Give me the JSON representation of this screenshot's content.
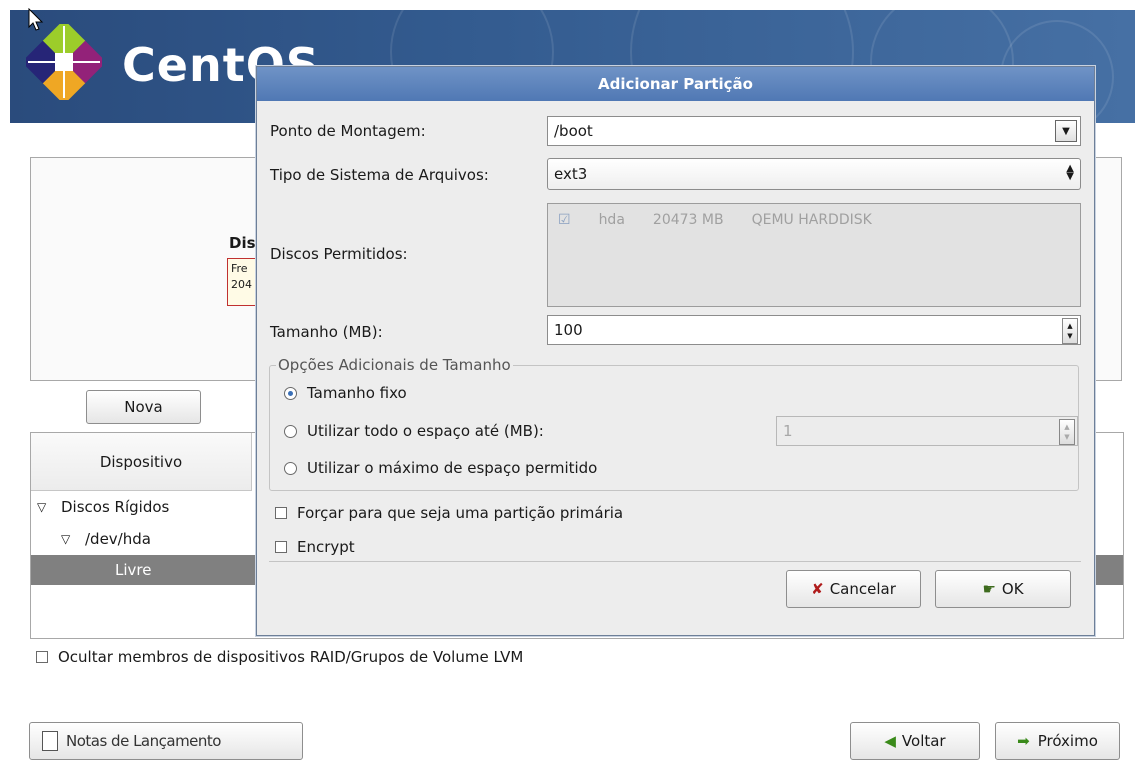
{
  "installer": {
    "logo_text": "CentOS",
    "disk_caption": "Dis",
    "disk_box_lines": [
      "Fre",
      "204"
    ],
    "nova_button": "Nova",
    "device_column_header": "Dispositivo",
    "tree": [
      {
        "label": "Discos Rígidos",
        "expanded": true
      },
      {
        "label": "/dev/hda",
        "expanded": true
      },
      {
        "label": "Livre",
        "selected": true
      }
    ],
    "hide_raid_label": "Ocultar membros de dispositivos RAID/Grupos de Volume LVM",
    "notes_button": "Notas de Lançamento",
    "back_button": "Voltar",
    "next_button": "Próximo"
  },
  "dialog": {
    "title": "Adicionar Partição",
    "mount_point_label": "Ponto de Montagem:",
    "mount_point_value": "/boot",
    "fs_type_label": "Tipo de Sistema de Arquivos:",
    "fs_type_value": "ext3",
    "allowed_drives_label": "Discos Permitidos:",
    "drives": [
      {
        "name": "hda",
        "size": "20473 MB",
        "model": "QEMU HARDDISK",
        "checked": true
      }
    ],
    "size_label": "Tamanho (MB):",
    "size_value": "100",
    "additional_size_legend": "Opções Adicionais de Tamanho",
    "opt_fixed": "Tamanho fixo",
    "opt_fill_up_to": "Utilizar todo o espaço até (MB):",
    "opt_fill_up_to_value": "1",
    "opt_fill_max": "Utilizar o máximo de espaço permitido",
    "force_primary_label": "Forçar para que seja uma partição primária",
    "encrypt_label": "Encrypt",
    "cancel_button": "Cancelar",
    "ok_button": "OK"
  },
  "colors": {
    "title_bar": "#5a80b9",
    "selected_row": "#808080",
    "banner": "#2f5588"
  }
}
